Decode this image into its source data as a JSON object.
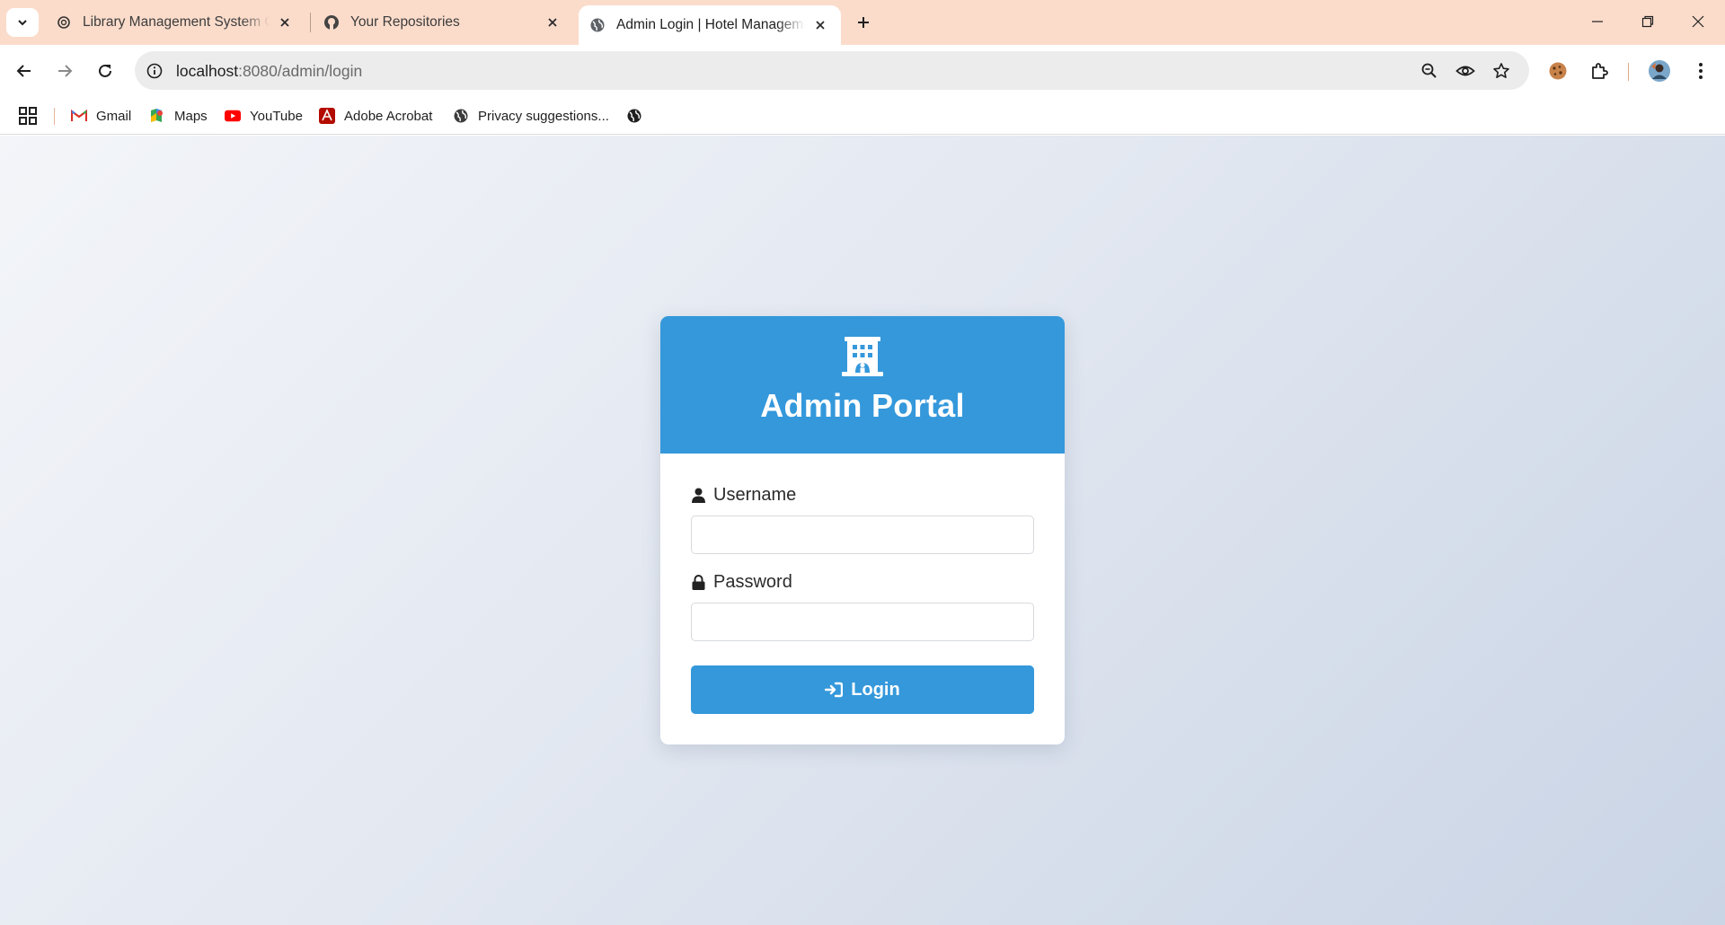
{
  "browser": {
    "tabs": [
      {
        "title": "Library Management System O",
        "favicon": "chatgpt-icon",
        "active": false
      },
      {
        "title": "Your Repositories",
        "favicon": "github-icon",
        "active": false
      },
      {
        "title": "Admin Login | Hotel Manageme",
        "favicon": "globe-icon",
        "active": true
      }
    ],
    "url_host": "localhost",
    "url_path": ":8080/admin/login",
    "bookmarks": [
      {
        "label": "Gmail",
        "icon": "gmail-icon"
      },
      {
        "label": "Maps",
        "icon": "maps-icon"
      },
      {
        "label": "YouTube",
        "icon": "youtube-icon"
      },
      {
        "label": "Adobe Acrobat",
        "icon": "acrobat-icon"
      },
      {
        "label": "Privacy suggestions...",
        "icon": "globe-icon"
      },
      {
        "label": "",
        "icon": "globe-icon"
      }
    ],
    "colors": {
      "tabstrip": "#fbdccb",
      "omnibox": "#ececec"
    }
  },
  "login": {
    "title": "Admin Portal",
    "header_icon": "hotel-icon",
    "username_label": "Username",
    "username_value": "",
    "password_label": "Password",
    "password_value": "",
    "button_label": "Login",
    "colors": {
      "primary": "#3498db",
      "card": "#ffffff"
    }
  }
}
